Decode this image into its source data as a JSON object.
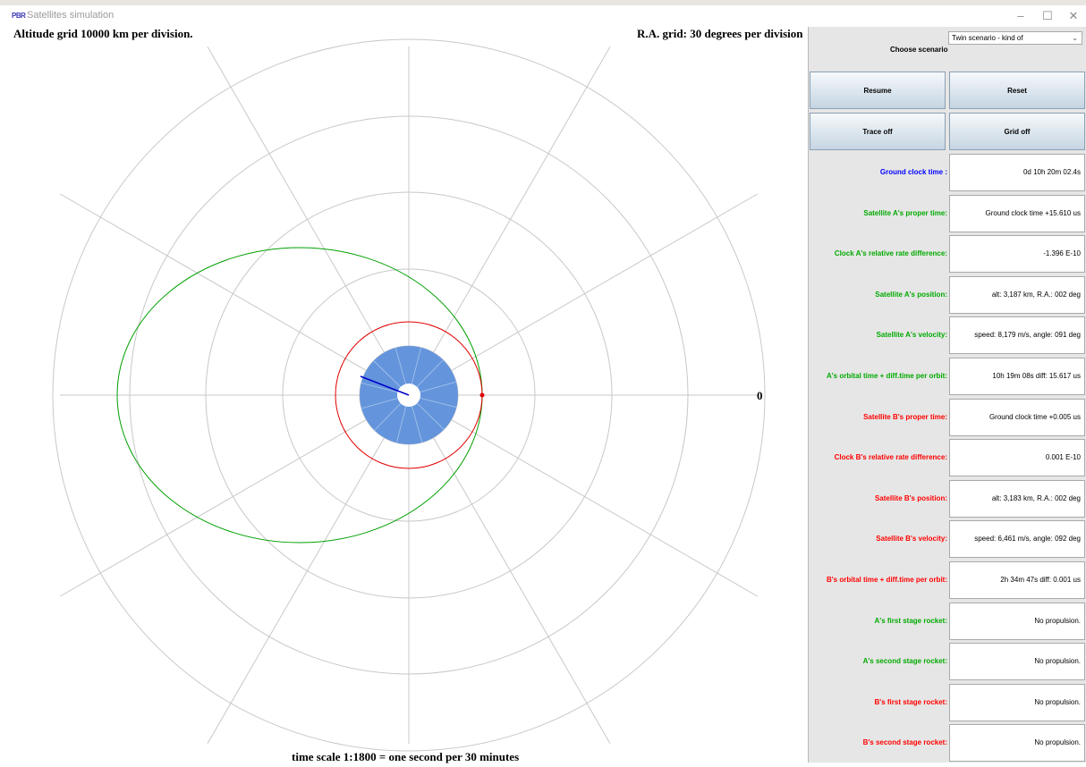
{
  "window": {
    "icon_text": "PBR",
    "title": "Satellites simulation",
    "minimize_glyph": "–",
    "maximize_glyph": "☐",
    "close_glyph": "✕"
  },
  "canvas": {
    "altitude_grid_label": "Altitude grid 10000 km per division.",
    "ra_grid_label": "R.A. grid: 30 degrees per division",
    "zero_label": "0",
    "time_scale_label": "time scale 1:1800 =  one second per 30 minutes"
  },
  "panel": {
    "scenario_label": "Choose scenario",
    "scenario_value": "Twin scenario - kind of",
    "buttons": {
      "resume": "Resume",
      "reset": "Reset",
      "trace": "Trace off",
      "grid": "Grid off"
    },
    "rows": [
      {
        "id": "ground-clock-time",
        "label": "Ground clock time :",
        "value": "0d 10h 20m 02.4s",
        "color": "#0000ff"
      },
      {
        "id": "sat-a-proper-time",
        "label": "Satellite A's proper time:",
        "value": "Ground clock time +15.610 us",
        "color": "#00aa00"
      },
      {
        "id": "clock-a-rate-diff",
        "label": "Clock A's relative rate difference:",
        "value": "-1.396 E-10",
        "color": "#00aa00"
      },
      {
        "id": "sat-a-position",
        "label": "Satellite A's position:",
        "value": "alt: 3,187 km, R.A.: 002 deg",
        "color": "#00aa00"
      },
      {
        "id": "sat-a-velocity",
        "label": "Satellite A's velocity:",
        "value": "speed: 8,179 m/s, angle: 091 deg",
        "color": "#00aa00"
      },
      {
        "id": "a-orbital-time",
        "label": "A's orbital time + diff.time per orbit:",
        "value": "10h 19m 08s   diff:  15.617 us",
        "color": "#00aa00"
      },
      {
        "id": "sat-b-proper-time",
        "label": "Satellite B's proper time:",
        "value": "Ground clock time +0.005 us",
        "color": "#ff0000"
      },
      {
        "id": "clock-b-rate-diff",
        "label": "Clock B's relative rate difference:",
        "value": "0.001 E-10",
        "color": "#ff0000"
      },
      {
        "id": "sat-b-position",
        "label": "Satellite B's position:",
        "value": "alt: 3,183 km, R.A.: 002 deg",
        "color": "#ff0000"
      },
      {
        "id": "sat-b-velocity",
        "label": "Satellite B's velocity:",
        "value": "speed: 6,461 m/s, angle: 092 deg",
        "color": "#ff0000"
      },
      {
        "id": "b-orbital-time",
        "label": "B's orbital time + diff.time per orbit:",
        "value": "2h 34m 47s   diff:  0.001 us",
        "color": "#ff0000"
      },
      {
        "id": "a-first-stage",
        "label": "A's first stage rocket:",
        "value": "No propulsion.",
        "color": "#00aa00"
      },
      {
        "id": "a-second-stage",
        "label": "A's second stage rocket:",
        "value": "No propulsion.",
        "color": "#00aa00"
      },
      {
        "id": "b-first-stage",
        "label": "B's first stage rocket:",
        "value": "No propulsion.",
        "color": "#ff0000"
      },
      {
        "id": "b-second-stage",
        "label": "B's second stage rocket:",
        "value": "No propulsion.",
        "color": "#ff0000"
      }
    ]
  },
  "colors": {
    "earth": "#6495dc",
    "grid": "#c8c8c8",
    "orbit_a": "#00a000",
    "orbit_b": "#e00000",
    "ground_hand": "#0000cc"
  }
}
